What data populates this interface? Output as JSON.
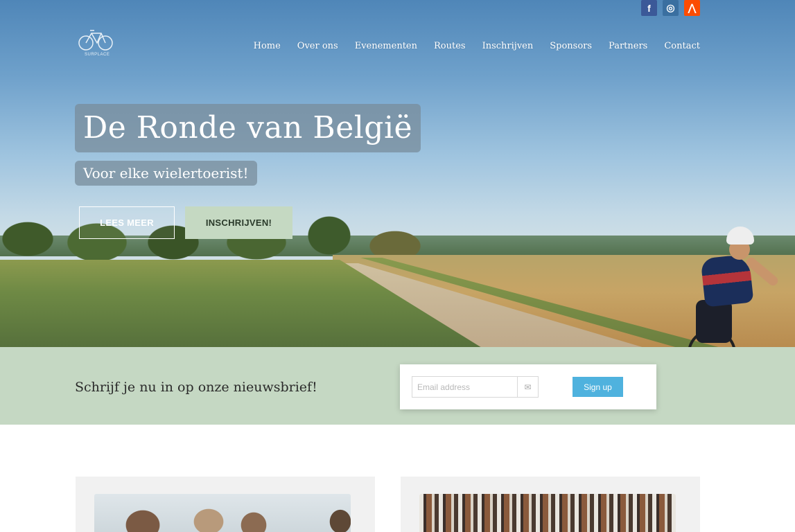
{
  "social": {
    "items": [
      {
        "name": "facebook",
        "glyph": "f",
        "color": "#3b5998"
      },
      {
        "name": "instagram",
        "glyph": "◎",
        "color": "#3a6fa0"
      },
      {
        "name": "strava",
        "glyph": "⋀",
        "color": "#fc4c02"
      }
    ]
  },
  "logo": {
    "text": "SURPLACE"
  },
  "nav": {
    "items": [
      "Home",
      "Over ons",
      "Evenementen",
      "Routes",
      "Inschrijven",
      "Sponsors",
      "Partners",
      "Contact"
    ]
  },
  "hero": {
    "title": "De Ronde van België",
    "subtitle": "Voor elke wielertoerist!",
    "btn_lees": "LEES MEER",
    "btn_inschrijven": "INSCHRIJVEN!"
  },
  "newsletter": {
    "text": "Schrijf je nu in op onze nieuwsbrief!",
    "email_placeholder": "Email address",
    "signup_label": "Sign up"
  },
  "colors": {
    "accent_green": "#c5d8c3",
    "signup_blue": "#4fb2de"
  }
}
